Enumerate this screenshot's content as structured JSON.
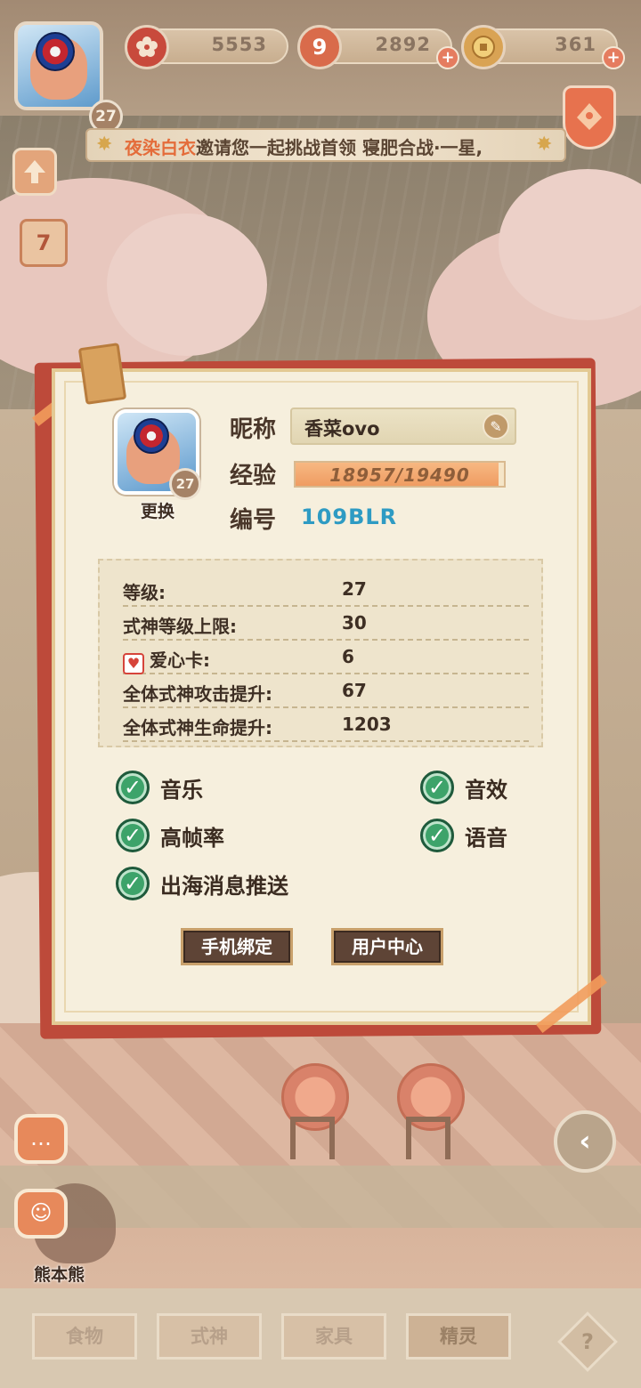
{
  "resources": {
    "flower": "5553",
    "magatama": "2892",
    "coin": "361",
    "magatama_glyph": "9"
  },
  "player": {
    "level": "27"
  },
  "banner": {
    "name": "夜染白衣",
    "message": "邀请您一起挑战首领 寝肥合战·一星,"
  },
  "calendar_day": "7",
  "profile": {
    "change_label": "更换",
    "nickname_label": "昵称",
    "nickname": "香菜ovo",
    "exp_label": "经验",
    "exp_text": "18957/19490",
    "exp_current": 18957,
    "exp_max": 19490,
    "id_label": "编号",
    "id_value": "109BLR"
  },
  "stats": [
    {
      "label": "等级:",
      "value": "27"
    },
    {
      "label": "式神等级上限:",
      "value": "30"
    },
    {
      "label": "爱心卡:",
      "value": "6"
    },
    {
      "label": "全体式神攻击提升:",
      "value": "67"
    },
    {
      "label": "全体式神生命提升:",
      "value": "1203"
    }
  ],
  "settings": {
    "music": "音乐",
    "sfx": "音效",
    "high_fps": "高帧率",
    "voice": "语音",
    "push": "出海消息推送"
  },
  "buttons": {
    "bind_phone": "手机绑定",
    "user_center": "用户中心"
  },
  "bear_name": "熊本熊",
  "tabs": [
    "食物",
    "式神",
    "家具",
    "精灵"
  ],
  "help": "?",
  "colors": {
    "accent_orange": "#e46c3a",
    "id_blue": "#2e9bc3",
    "check_green": "#3da36a",
    "panel_red": "#bd4a3a"
  }
}
